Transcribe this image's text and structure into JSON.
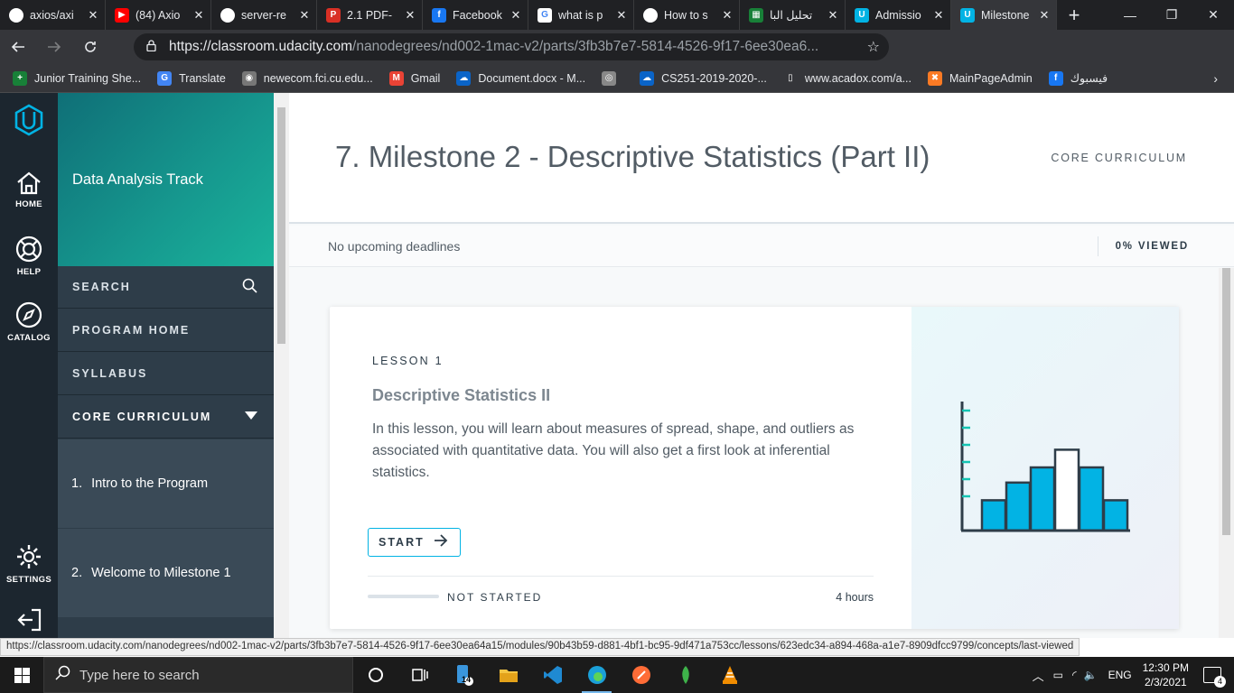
{
  "browser": {
    "tabs": [
      {
        "title": "axios/axi",
        "icon": "github-icon",
        "color": "#ffffff",
        "glyph": "",
        "active": false
      },
      {
        "title": "(84) Axio",
        "icon": "youtube-icon",
        "color": "#ff0000",
        "glyph": "▶",
        "active": false
      },
      {
        "title": "server-re",
        "icon": "github-icon",
        "color": "#ffffff",
        "glyph": "",
        "active": false
      },
      {
        "title": "2.1 PDF-",
        "icon": "pdf-icon",
        "color": "#d93025",
        "glyph": "P",
        "active": false
      },
      {
        "title": "Facebook",
        "icon": "facebook-icon",
        "color": "#1877f2",
        "glyph": "f",
        "active": false
      },
      {
        "title": "what is p",
        "icon": "google-icon",
        "color": "#ffffff",
        "glyph": "G",
        "active": false
      },
      {
        "title": "How to s",
        "icon": "github-icon",
        "color": "#ffffff",
        "glyph": "",
        "active": false
      },
      {
        "title": "تحليل البا",
        "icon": "sheet-icon",
        "color": "#188038",
        "glyph": "▦",
        "active": false
      },
      {
        "title": "Admissio",
        "icon": "udacity-icon",
        "color": "#02b3e4",
        "glyph": "U",
        "active": false
      },
      {
        "title": "Milestone",
        "icon": "udacity-icon",
        "color": "#02b3e4",
        "glyph": "U",
        "active": true
      }
    ],
    "window_controls": {
      "minimize": "—",
      "restore": "❐",
      "close": "✕"
    },
    "url_host": "https://classroom.udacity.com",
    "url_path": "/nanodegrees/nd002-1mac-v2/parts/3fb3b7e7-5814-4526-9f17-6ee30ea6...",
    "bookmarks": [
      {
        "label": "Junior Training She...",
        "icon": "sheets-plus-icon",
        "color": "#188038",
        "glyph": "+"
      },
      {
        "label": "Translate",
        "icon": "translate-icon",
        "color": "#4285f4",
        "glyph": "G"
      },
      {
        "label": "newecom.fci.cu.edu...",
        "icon": "globe-icon",
        "color": "#777777",
        "glyph": "◉"
      },
      {
        "label": "Gmail",
        "icon": "gmail-icon",
        "color": "#ea4335",
        "glyph": "M"
      },
      {
        "label": "Document.docx - M...",
        "icon": "onedrive-icon",
        "color": "#0a64c8",
        "glyph": "☁"
      },
      {
        "label": "",
        "icon": "seal-icon",
        "color": "#888888",
        "glyph": "◎"
      },
      {
        "label": "CS251-2019-2020-...",
        "icon": "onedrive-icon",
        "color": "#0a64c8",
        "glyph": "☁"
      },
      {
        "label": "www.acadox.com/a...",
        "icon": "page-icon",
        "color": "#35363a",
        "glyph": "▯"
      },
      {
        "label": "MainPageAdmin",
        "icon": "xampp-icon",
        "color": "#fb7a24",
        "glyph": "✖"
      },
      {
        "label": "فيسبوك",
        "icon": "facebook-icon",
        "color": "#1877f2",
        "glyph": "f"
      }
    ]
  },
  "rail": {
    "home": "HOME",
    "help": "HELP",
    "catalog": "CATALOG",
    "settings": "SETTINGS"
  },
  "sidebar": {
    "track": "Data Analysis Track",
    "search": "SEARCH",
    "program_home": "PROGRAM HOME",
    "syllabus": "SYLLABUS",
    "core_curriculum": "CORE CURRICULUM",
    "lessons": [
      {
        "num": "1.",
        "label": "Intro to the Program"
      },
      {
        "num": "2.",
        "label": "Welcome to Milestone 1"
      }
    ]
  },
  "main": {
    "title": "7. Milestone 2 - Descriptive Statistics (Part II)",
    "section_label": "CORE CURRICULUM",
    "deadlines": "No upcoming deadlines",
    "viewed": "0% VIEWED"
  },
  "card": {
    "lesson_label": "LESSON 1",
    "title": "Descriptive Statistics II",
    "description": "In this lesson, you will learn about measures of spread, shape, and outliers as associated with quantitative data. You will also get a first look at inferential statistics.",
    "start_label": "START",
    "progress": 0,
    "status": "NOT STARTED",
    "duration": "4 hours",
    "illustration_bars": [
      0.24,
      0.38,
      0.5,
      0.64,
      0.5,
      0.24
    ],
    "highlight_bar": 3,
    "colors": {
      "bar": "#02b3e4",
      "highlight": "#ffffff",
      "axis": "#2e3d49",
      "tick": "#15c4b3"
    }
  },
  "statusbar": {
    "url": "https://classroom.udacity.com/nanodegrees/nd002-1mac-v2/parts/3fb3b7e7-5814-4526-9f17-6ee30ea64a15/modules/90b43b59-d881-4bf1-bc95-9df471a753cc/lessons/623edc34-a894-468a-a1e7-8909dfcc9799/concepts/last-viewed"
  },
  "taskbar": {
    "search_placeholder": "Type here to search",
    "badge": "14",
    "lang": "ENG",
    "time": "12:30 PM",
    "date": "2/3/2021",
    "notifications": "4"
  }
}
